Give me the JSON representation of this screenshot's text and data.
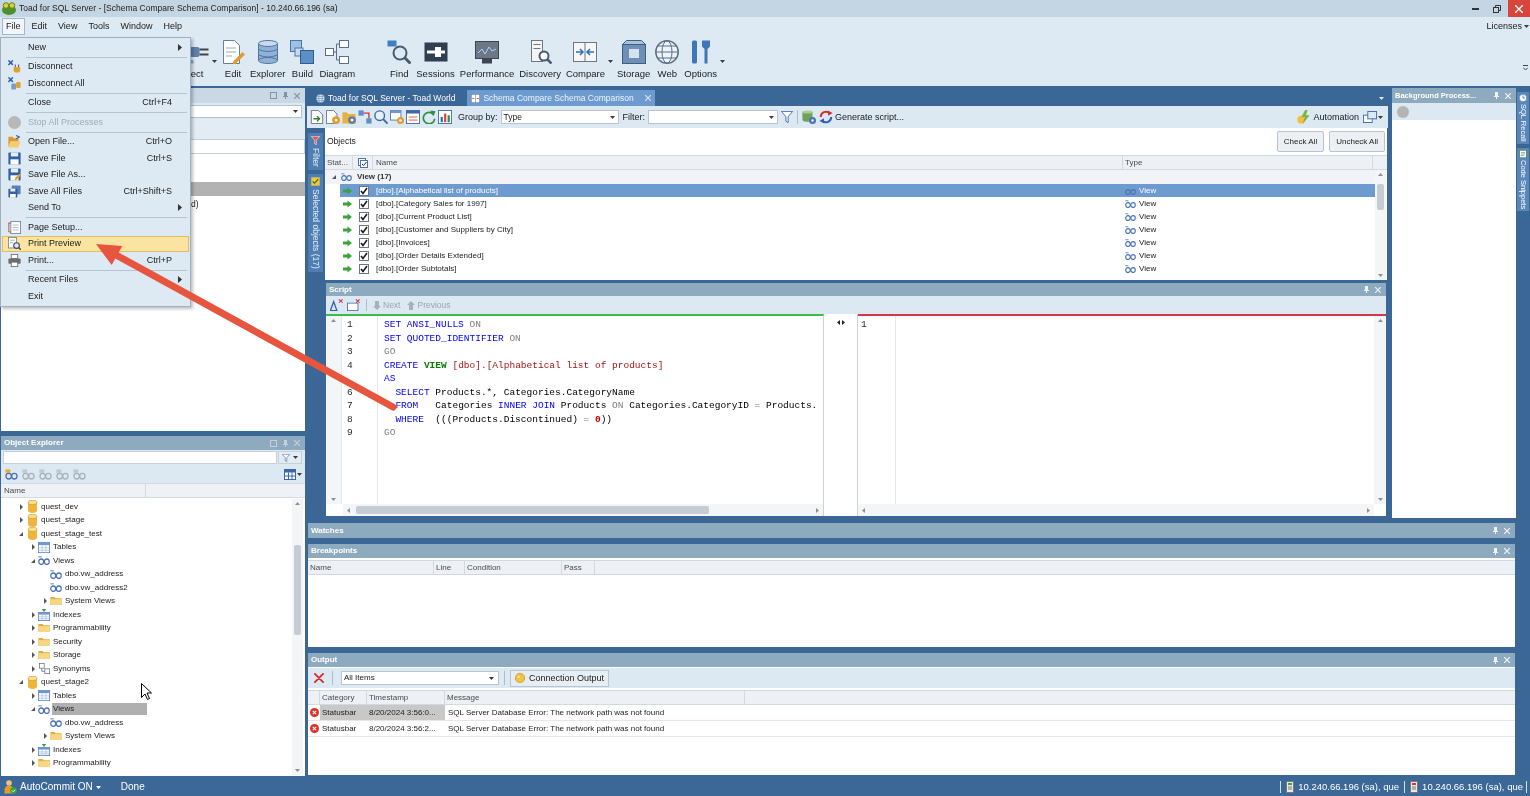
{
  "window": {
    "title": "Toad for SQL Server - [Schema Compare Schema Comparison] - 10.240.66.196 (sa)"
  },
  "menu_bar": [
    {
      "label": "File",
      "selected": true
    },
    {
      "label": "Edit",
      "selected": false
    },
    {
      "label": "View",
      "selected": false
    },
    {
      "label": "Tools",
      "selected": false
    },
    {
      "label": "Window",
      "selected": false
    },
    {
      "label": "Help",
      "selected": false
    }
  ],
  "licenses_menu": "Licenses",
  "toolbar": {
    "groups": [
      [
        {
          "label": "ect",
          "dropdown": true
        },
        {
          "label": "Edit",
          "dropdown": false
        },
        {
          "label": "Explorer",
          "dropdown": false
        },
        {
          "label": "Build",
          "dropdown": false
        },
        {
          "label": "Diagram",
          "dropdown": false
        }
      ],
      [
        {
          "label": "Find",
          "dropdown": false
        },
        {
          "label": "Sessions",
          "dropdown": false
        },
        {
          "label": "Performance",
          "dropdown": false
        },
        {
          "label": "Discovery",
          "dropdown": false
        },
        {
          "label": "Compare",
          "dropdown": true
        },
        {
          "label": "Storage",
          "dropdown": false
        },
        {
          "label": "Web",
          "dropdown": false
        },
        {
          "label": "Options",
          "dropdown": true
        }
      ]
    ]
  },
  "file_menu": {
    "groups": [
      [
        {
          "label": "New",
          "submenu": true,
          "disabled": false,
          "selected": false
        }
      ],
      [
        {
          "label": "Disconnect",
          "submenu": false,
          "disabled": false,
          "selected": false
        },
        {
          "label": "Disconnect All",
          "submenu": false,
          "disabled": false,
          "selected": false
        }
      ],
      [
        {
          "label": "Close",
          "shortcut": "Ctrl+F4",
          "submenu": false,
          "disabled": false,
          "selected": false
        }
      ],
      [
        {
          "label": "Stop All Processes",
          "submenu": false,
          "disabled": true,
          "selected": false
        }
      ],
      [
        {
          "label": "Open File...",
          "shortcut": "Ctrl+O",
          "submenu": false,
          "disabled": false,
          "selected": false
        },
        {
          "label": "Save File",
          "shortcut": "Ctrl+S",
          "submenu": false,
          "disabled": false,
          "selected": false
        },
        {
          "label": "Save File As...",
          "submenu": false,
          "disabled": false,
          "selected": false
        },
        {
          "label": "Save All Files",
          "shortcut": "Ctrl+Shift+S",
          "submenu": false,
          "disabled": false,
          "selected": false
        },
        {
          "label": "Send To",
          "submenu": true,
          "disabled": false,
          "selected": false
        }
      ],
      [
        {
          "label": "Page Setup...",
          "submenu": false,
          "disabled": false,
          "selected": false
        },
        {
          "label": "Print Preview",
          "submenu": false,
          "disabled": false,
          "selected": true
        },
        {
          "label": "Print...",
          "shortcut": "Ctrl+P",
          "submenu": false,
          "disabled": false,
          "selected": false
        }
      ],
      [
        {
          "label": "Recent Files",
          "submenu": true,
          "disabled": false,
          "selected": false
        },
        {
          "label": "Exit",
          "submenu": false,
          "disabled": false,
          "selected": false
        }
      ]
    ]
  },
  "panel_under_menu": {
    "item_text": "d)"
  },
  "document_tabs": [
    {
      "label": "Toad for SQL Server - Toad World",
      "selected": false
    },
    {
      "label": "Schema Compare Schema Comparison",
      "selected": true
    }
  ],
  "compare_toolbar": {
    "group_by_label": "Group by:",
    "group_by_value": "Type",
    "filter_label": "Filter:",
    "generate_button": "Generate script...",
    "automation_button": "Automation"
  },
  "compare_side_tabs": [
    {
      "label": "Filter"
    },
    {
      "label": "Selected objects (17)"
    }
  ],
  "objects": {
    "title": "Objects",
    "buttons": [
      "Check All",
      "Uncheck All"
    ],
    "columns": [
      "Stat...",
      "Name",
      "Type"
    ],
    "group": {
      "label": "View (17)",
      "expanded": true
    },
    "rows": [
      {
        "name": "[dbo].[Alphabetical list of products]",
        "type": "View",
        "checked": true,
        "selected": true
      },
      {
        "name": "[dbo].[Category Sales for 1997]",
        "type": "View",
        "checked": true,
        "selected": false
      },
      {
        "name": "[dbo].[Current Product List]",
        "type": "View",
        "checked": true,
        "selected": false
      },
      {
        "name": "[dbo].[Customer and Suppliers by City]",
        "type": "View",
        "checked": true,
        "selected": false
      },
      {
        "name": "[dbo].[Invoices]",
        "type": "View",
        "checked": true,
        "selected": false
      },
      {
        "name": "[dbo].[Order Details Extended]",
        "type": "View",
        "checked": true,
        "selected": false
      },
      {
        "name": "[dbo].[Order Subtotals]",
        "type": "View",
        "checked": true,
        "selected": false
      }
    ]
  },
  "script": {
    "title": "Script",
    "nav_buttons": [
      {
        "label": "Next",
        "disabled": true
      },
      {
        "label": "Previous",
        "disabled": true
      }
    ],
    "left_lines": [
      {
        "number": "1",
        "tokens": [
          {
            "kind": "keyword",
            "text": "SET ANSI_NULLS "
          },
          {
            "kind": "operator",
            "text": "ON"
          }
        ]
      },
      {
        "number": "2",
        "tokens": [
          {
            "kind": "keyword",
            "text": "SET QUOTED_IDENTIFIER "
          },
          {
            "kind": "operator",
            "text": "ON"
          }
        ]
      },
      {
        "number": "3",
        "tokens": [
          {
            "kind": "operator",
            "text": "GO"
          }
        ]
      },
      {
        "number": "4",
        "tokens": [
          {
            "kind": "keyword",
            "text": "CREATE "
          },
          {
            "kind": "type",
            "text": "VIEW "
          },
          {
            "kind": "identifier",
            "text": "[dbo].[Alphabetical list of products]"
          }
        ]
      },
      {
        "tokens": [
          {
            "kind": "keyword",
            "text": "AS"
          }
        ]
      },
      {
        "number": "6",
        "tokens": [
          {
            "kind": "keyword",
            "text": "  SELECT "
          },
          {
            "kind": "plain",
            "text": "Products.*, Categories.CategoryName"
          }
        ]
      },
      {
        "number": "7",
        "tokens": [
          {
            "kind": "keyword",
            "text": "  FROM "
          },
          {
            "kind": "plain",
            "text": "  Categories "
          },
          {
            "kind": "keyword",
            "text": "INNER JOIN "
          },
          {
            "kind": "plain",
            "text": "Products "
          },
          {
            "kind": "operator",
            "text": "ON "
          },
          {
            "kind": "plain",
            "text": "Categories.CategoryID "
          },
          {
            "kind": "operator",
            "text": "= "
          },
          {
            "kind": "plain",
            "text": "Products."
          }
        ]
      },
      {
        "number": "8",
        "tokens": [
          {
            "kind": "keyword",
            "text": "  WHERE "
          },
          {
            "kind": "plain",
            "text": " (((Products.Discontinued) "
          },
          {
            "kind": "operator",
            "text": "= "
          },
          {
            "kind": "number",
            "text": "0"
          },
          {
            "kind": "plain",
            "text": "))"
          }
        ]
      },
      {
        "number": "9",
        "tokens": [
          {
            "kind": "operator",
            "text": "GO"
          }
        ]
      }
    ],
    "right_lines": [
      {
        "number": "1"
      }
    ]
  },
  "background_processes": {
    "title": "Background Process..."
  },
  "side_tabs_right": [
    {
      "label": "SQL Recall"
    },
    {
      "label": "Code Snippets"
    }
  ],
  "object_explorer": {
    "title": "Object Explorer",
    "toolbar": [
      {
        "disabled": false
      },
      {
        "disabled": true
      },
      {
        "disabled": true
      },
      {
        "disabled": true
      },
      {
        "disabled": true
      }
    ],
    "column": "Name",
    "tree": [
      {
        "label": "quest_dev",
        "kind": "database",
        "expanded": false,
        "selected": false
      },
      {
        "label": "quest_stage",
        "kind": "database",
        "expanded": false,
        "selected": false
      },
      {
        "label": "quest_stage_test",
        "kind": "database",
        "expanded": true,
        "selected": false,
        "children": [
          {
            "label": "Tables",
            "kind": "tables",
            "expanded": false,
            "selected": false
          },
          {
            "label": "Views",
            "kind": "views",
            "expanded": true,
            "selected": false,
            "children": [
              {
                "label": "dbo.vw_address",
                "kind": "view",
                "selected": false
              },
              {
                "label": "dbo.vw_address2",
                "kind": "view",
                "selected": false
              },
              {
                "label": "System Views",
                "kind": "folder",
                "expanded": false,
                "selected": false
              }
            ]
          },
          {
            "label": "Indexes",
            "kind": "indexes",
            "expanded": false,
            "selected": false
          },
          {
            "label": "Programmability",
            "kind": "folder",
            "expanded": false,
            "selected": false
          },
          {
            "label": "Security",
            "kind": "folder",
            "expanded": false,
            "selected": false
          },
          {
            "label": "Storage",
            "kind": "folder",
            "expanded": false,
            "selected": false
          },
          {
            "label": "Synonyms",
            "kind": "synonyms",
            "expanded": false,
            "selected": false
          }
        ]
      },
      {
        "label": "quest_stage2",
        "kind": "database",
        "expanded": true,
        "selected": false,
        "children": [
          {
            "label": "Tables",
            "kind": "tables",
            "expanded": false,
            "selected": false
          },
          {
            "label": "Views",
            "kind": "views",
            "expanded": true,
            "selected": true,
            "children": [
              {
                "label": "dbo.vw_address",
                "kind": "view",
                "selected": false
              },
              {
                "label": "System Views",
                "kind": "folder",
                "expanded": false,
                "selected": false
              }
            ]
          },
          {
            "label": "Indexes",
            "kind": "indexes",
            "expanded": false,
            "selected": false
          },
          {
            "label": "Programmability",
            "kind": "folder",
            "expanded": false,
            "selected": false
          }
        ]
      }
    ]
  },
  "watches": {
    "title": "Watches"
  },
  "breakpoints": {
    "title": "Breakpoints",
    "columns": [
      "Name",
      "Line",
      "Condition",
      "Pass"
    ]
  },
  "output": {
    "title": "Output",
    "filter_value": "All Items",
    "connection_button": "Connection Output",
    "columns": [
      "Category",
      "Timestamp",
      "Message"
    ],
    "rows": [
      {
        "category": "Statusbar",
        "timestamp": "8/20/2024 3:56:0...",
        "message": "SQL Server Database Error: The network path was not found",
        "selected": true
      },
      {
        "category": "Statusbar",
        "timestamp": "8/20/2024 3:56:2...",
        "message": "SQL Server Database Error: The network path was not found",
        "selected": false
      }
    ]
  },
  "status_bar": {
    "autocommit": "AutoCommit ON",
    "status": "Done",
    "connections": [
      "10.240.66.196 (sa), que",
      "10.240.66.196 (sa), que"
    ]
  }
}
